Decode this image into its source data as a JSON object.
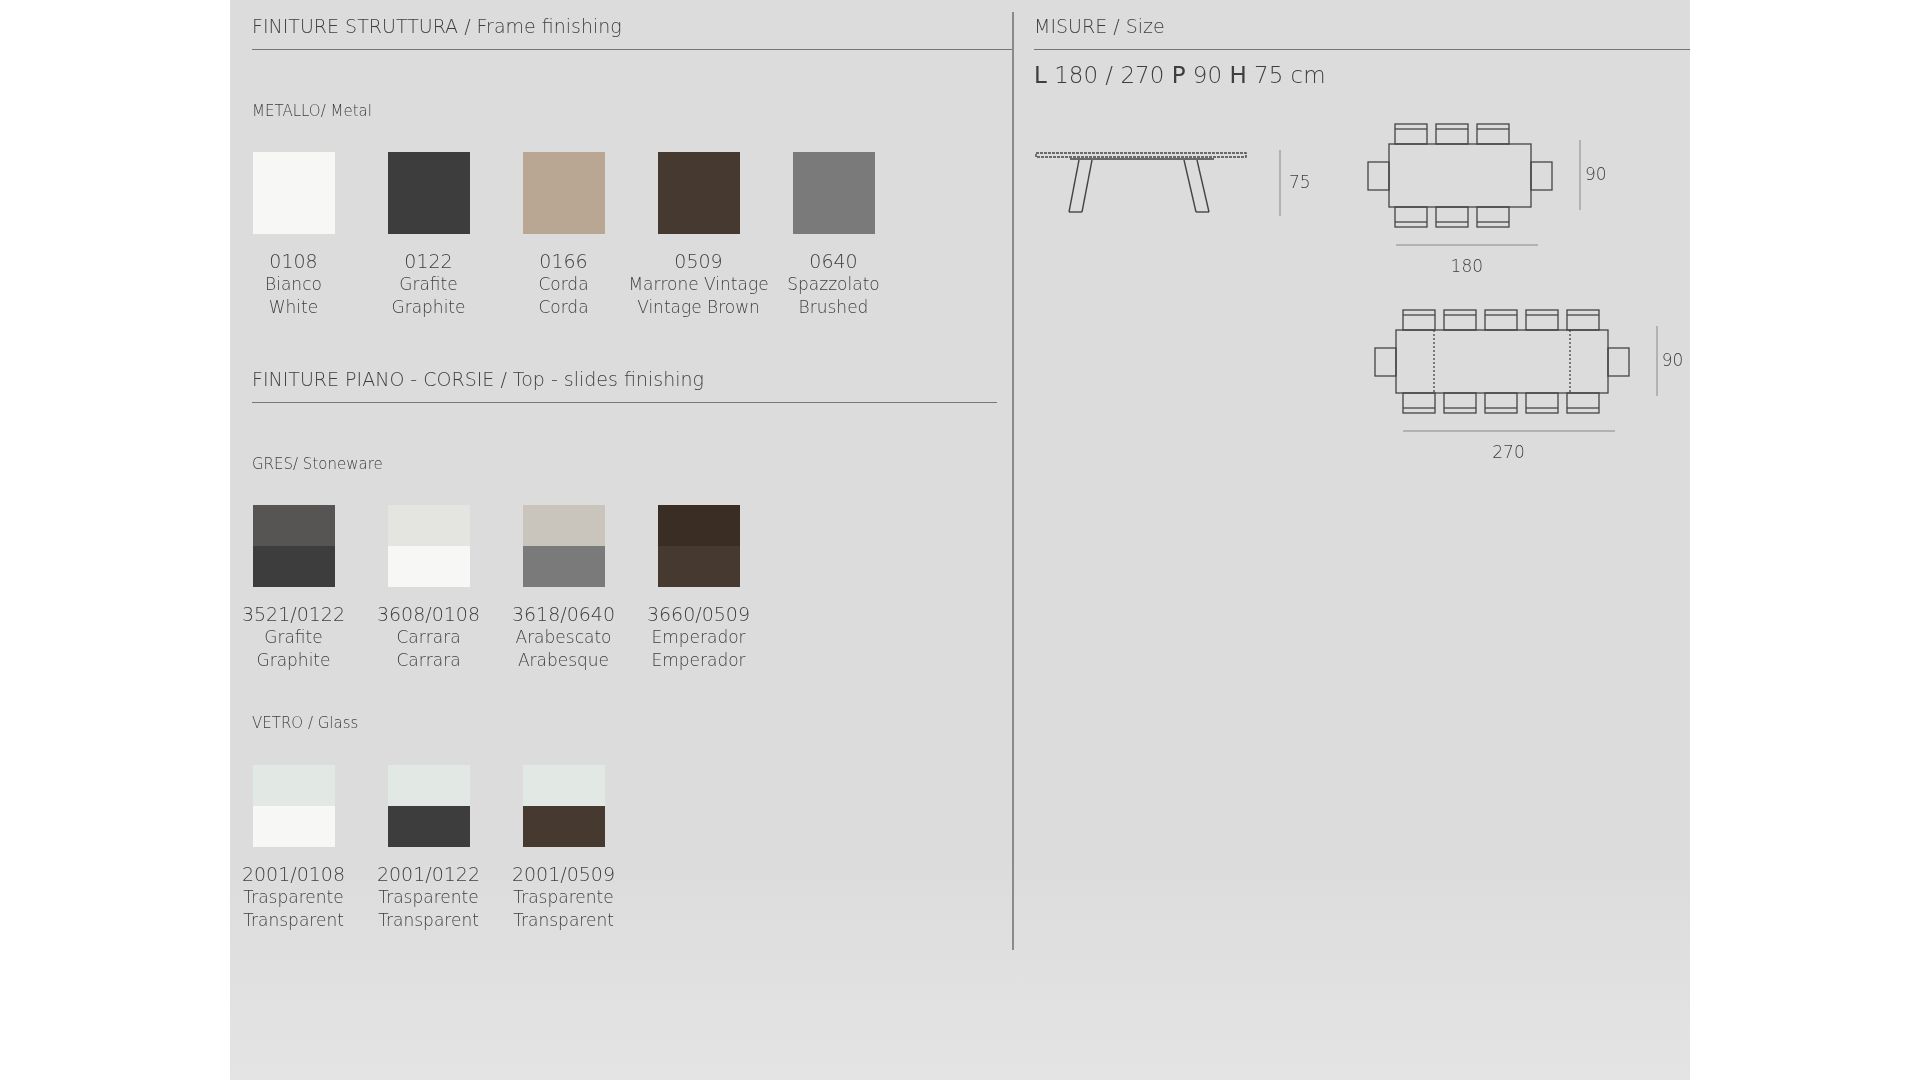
{
  "finishes": [
    {
      "title": "FINITURE STRUTTURA / Frame finishing",
      "groups": [
        {
          "title": "METALLO/ Metal",
          "swatches": [
            {
              "code": "0108",
              "name_it": "Bianco",
              "name_en": "White",
              "color": "#f7f7f5"
            },
            {
              "code": "0122",
              "name_it": "Grafite",
              "name_en": "Graphite",
              "color": "#3d3d3d"
            },
            {
              "code": "0166",
              "name_it": "Corda",
              "name_en": "Corda",
              "color": "#b9a794"
            },
            {
              "code": "0509",
              "name_it": "Marrone Vintage",
              "name_en": "Vintage Brown",
              "color": "#463a30"
            },
            {
              "code": "0640",
              "name_it": "Spazzolato",
              "name_en": "Brushed",
              "color": "#7a7a7a"
            }
          ]
        }
      ]
    },
    {
      "title": "FINITURE PIANO - CORSIE / Top - slides finishing",
      "groups": [
        {
          "title": "GRES/ Stoneware",
          "swatches": [
            {
              "code": "3521/0122",
              "name_it": "Grafite",
              "name_en": "Graphite",
              "color": "#575553",
              "base": {
                "color": "#3d3d3d"
              }
            },
            {
              "code": "3608/0108",
              "name_it": "Carrara",
              "name_en": "Carrara",
              "color": "#e4e4e1",
              "base": {
                "color": "#f7f7f5"
              }
            },
            {
              "code": "3618/0640",
              "name_it": "Arabescato",
              "name_en": "Arabesque",
              "color": "#c9c5bd",
              "base": {
                "color": "#7a7a7a"
              }
            },
            {
              "code": "3660/0509",
              "name_it": "Emperador",
              "name_en": "Emperador",
              "color": "#3a2e24",
              "base": {
                "color": "#463a30"
              }
            }
          ]
        },
        {
          "title": "VETRO / Glass",
          "swatches": [
            {
              "code": "2001/0108",
              "name_it": "Trasparente",
              "name_en": "Transparent",
              "color": "#e2e8e4",
              "base": {
                "color": "#f7f7f5"
              }
            },
            {
              "code": "2001/0122",
              "name_it": "Trasparente",
              "name_en": "Transparent",
              "color": "#e2e8e4",
              "base": {
                "color": "#3d3d3d"
              }
            },
            {
              "code": "2001/0509",
              "name_it": "Trasparente",
              "name_en": "Transparent",
              "color": "#e2e8e4",
              "base": {
                "color": "#463a30"
              }
            }
          ]
        }
      ]
    }
  ],
  "size": {
    "title": "MISURE / Size",
    "dimensions": "**L** 180 / 270 **P** 90 **H** 75 cm",
    "views": [
      {
        "kind": "side",
        "height_label": "75"
      },
      {
        "kind": "top",
        "depth_label": "90",
        "length_label": "180"
      },
      {
        "kind": "top_extended",
        "depth_label": "90",
        "length_label": "270"
      }
    ]
  }
}
